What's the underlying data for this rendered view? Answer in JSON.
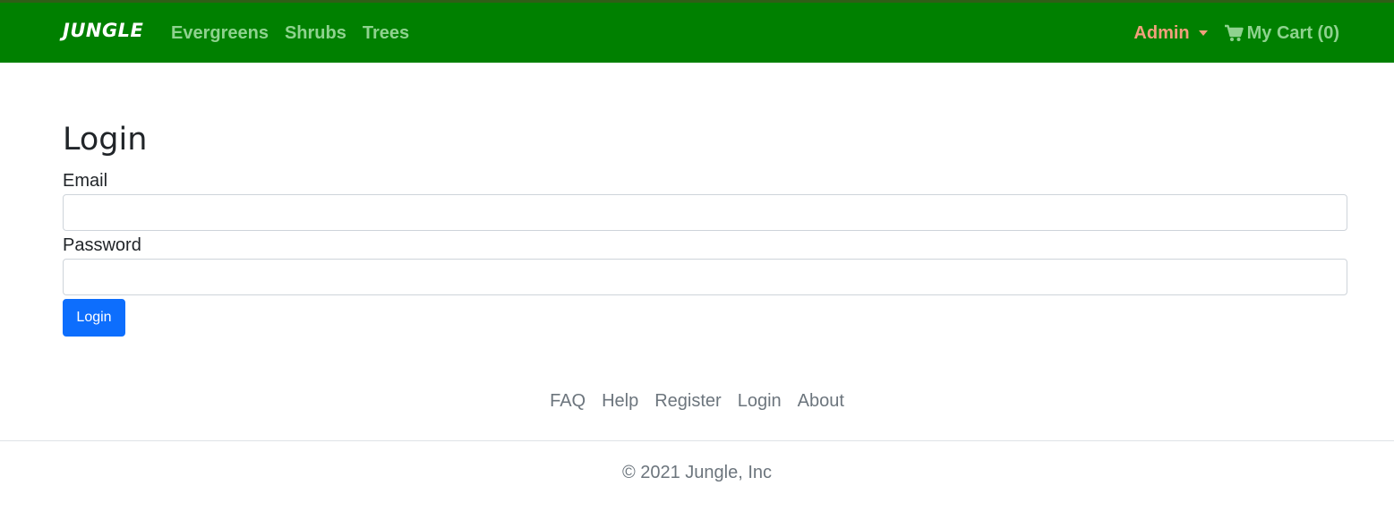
{
  "navbar": {
    "brand": "JUNGLE",
    "links": [
      {
        "label": "Evergreens"
      },
      {
        "label": "Shrubs"
      },
      {
        "label": "Trees"
      }
    ],
    "admin_label": "Admin",
    "cart_label": "My Cart (0)",
    "cart_icon": "cart-icon",
    "admin_caret_icon": "caret-down-icon",
    "colors": {
      "background": "#008000",
      "link": "#8fd28f",
      "admin": "#f2a07c"
    }
  },
  "main": {
    "title": "Login",
    "email_label": "Email",
    "email_value": "",
    "password_label": "Password",
    "password_value": "",
    "submit_label": "Login",
    "submit_color": "#0d6efd"
  },
  "footer": {
    "links": [
      {
        "label": "FAQ"
      },
      {
        "label": "Help"
      },
      {
        "label": "Register"
      },
      {
        "label": "Login"
      },
      {
        "label": "About"
      }
    ],
    "copyright": "© 2021 Jungle, Inc"
  }
}
